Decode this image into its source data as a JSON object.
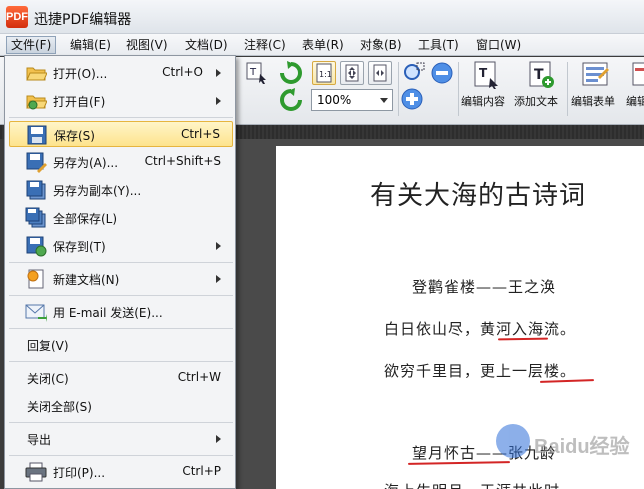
{
  "app": {
    "icon_text": "PDF",
    "title": "迅捷PDF编辑器"
  },
  "menubar": [
    {
      "label": "文件(F)",
      "active": true
    },
    {
      "label": "编辑(E)"
    },
    {
      "label": "视图(V)"
    },
    {
      "label": "文档(D)"
    },
    {
      "label": "注释(C)"
    },
    {
      "label": "表单(R)"
    },
    {
      "label": "对象(B)"
    },
    {
      "label": "工具(T)"
    },
    {
      "label": "窗口(W)"
    }
  ],
  "toolbar": {
    "zoom_value": "100%",
    "edit_content": "编辑内容",
    "add_text": "添加文本",
    "edit_form": "编辑表单",
    "edit_more": "编辑"
  },
  "file_menu": {
    "items": [
      {
        "label": "打开(O)...",
        "shortcut": "Ctrl+O",
        "submenu": true,
        "icon": "folder-open-icon"
      },
      {
        "label": "打开自(F)",
        "shortcut": "",
        "submenu": true,
        "icon": "folder-from-icon"
      },
      {
        "label": "保存(S)",
        "shortcut": "Ctrl+S",
        "submenu": false,
        "icon": "save-icon",
        "highlighted": true
      },
      {
        "label": "另存为(A)...",
        "shortcut": "Ctrl+Shift+S",
        "submenu": false,
        "icon": "save-as-icon"
      },
      {
        "label": "另存为副本(Y)...",
        "shortcut": "",
        "submenu": false,
        "icon": "save-copy-icon"
      },
      {
        "label": "全部保存(L)",
        "shortcut": "",
        "submenu": false,
        "icon": "save-all-icon"
      },
      {
        "label": "保存到(T)",
        "shortcut": "",
        "submenu": true,
        "icon": "save-to-icon"
      },
      {
        "label": "新建文档(N)",
        "shortcut": "",
        "submenu": true,
        "icon": "new-document-icon"
      },
      {
        "label": "用 E-mail 发送(E)...",
        "shortcut": "",
        "submenu": false,
        "icon": "email-icon"
      },
      {
        "label": "回复(V)",
        "shortcut": "",
        "submenu": false,
        "icon": ""
      },
      {
        "label": "关闭(C)",
        "shortcut": "Ctrl+W",
        "submenu": false,
        "icon": ""
      },
      {
        "label": "关闭全部(S)",
        "shortcut": "",
        "submenu": false,
        "icon": ""
      },
      {
        "label": "导出",
        "shortcut": "",
        "submenu": true,
        "icon": ""
      },
      {
        "label": "打印(P)...",
        "shortcut": "Ctrl+P",
        "submenu": false,
        "icon": "printer-icon"
      }
    ]
  },
  "document": {
    "title": "有关大海的古诗词",
    "lines": [
      "登鹳雀楼——王之涣",
      "白日依山尽，黄河入海流。",
      "欲穷千里目，更上一层楼。",
      "望月怀古——张九龄",
      "海上生明月，天涯共此时。"
    ]
  },
  "watermark": {
    "text": "Baidu经验"
  },
  "colors": {
    "highlight_bg": "#fde38d",
    "underline": "#d32525",
    "page_bg": "#ffffff",
    "workspace_bg": "#4a4a4a"
  }
}
